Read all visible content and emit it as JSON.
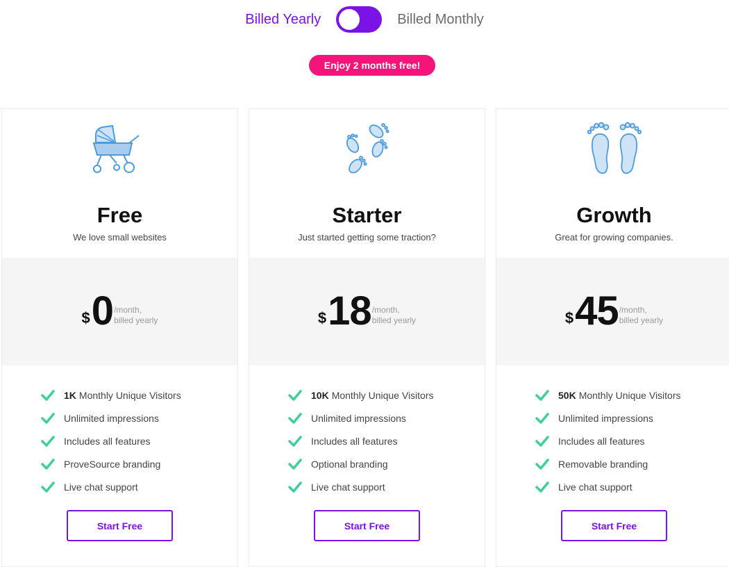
{
  "billing": {
    "yearly_label": "Billed Yearly",
    "monthly_label": "Billed Monthly",
    "promo": "Enjoy 2 months free!"
  },
  "colors": {
    "accent": "#7b12e8",
    "promo": "#f5157a",
    "check": "#3ecf9b",
    "icon": "#4a9be0"
  },
  "plans": [
    {
      "icon": "baby-stroller-icon",
      "name": "Free",
      "tagline": "We love small websites",
      "currency": "$",
      "price": "0",
      "period_line1": "/month,",
      "period_line2": "billed yearly",
      "visitors_count": "1K",
      "visitors_label": "Monthly Unique Visitors",
      "features": [
        "Unlimited impressions",
        "Includes all features",
        "ProveSource branding",
        "Live chat support"
      ],
      "cta": "Start Free"
    },
    {
      "icon": "footprints-icon",
      "name": "Starter",
      "tagline": "Just started getting some traction?",
      "currency": "$",
      "price": "18",
      "period_line1": "/month,",
      "period_line2": "billed yearly",
      "visitors_count": "10K",
      "visitors_label": "Monthly Unique Visitors",
      "features": [
        "Unlimited impressions",
        "Includes all features",
        "Optional branding",
        "Live chat support"
      ],
      "cta": "Start Free"
    },
    {
      "icon": "feet-icon",
      "name": "Growth",
      "tagline": "Great for growing companies.",
      "currency": "$",
      "price": "45",
      "period_line1": "/month,",
      "period_line2": "billed yearly",
      "visitors_count": "50K",
      "visitors_label": "Monthly Unique Visitors",
      "features": [
        "Unlimited impressions",
        "Includes all features",
        "Removable branding",
        "Live chat support"
      ],
      "cta": "Start Free"
    }
  ]
}
